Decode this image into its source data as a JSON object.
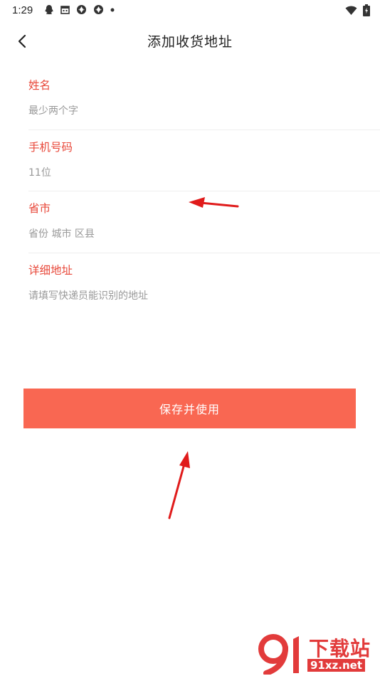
{
  "status_bar": {
    "time": "1:29",
    "left_icons": [
      "qq-icon",
      "calendar-icon",
      "aperture-icon",
      "aperture-icon",
      "dot-icon"
    ],
    "right_icons": [
      "wifi-icon",
      "battery-charging-icon"
    ]
  },
  "header": {
    "title": "添加收货地址"
  },
  "form": {
    "fields": [
      {
        "label": "姓名",
        "placeholder": "最少两个字",
        "value": ""
      },
      {
        "label": "手机号码",
        "placeholder": "11位",
        "value": ""
      },
      {
        "label": "省市",
        "placeholder": "省份 城市 区县",
        "value": ""
      },
      {
        "label": "详细地址",
        "placeholder": "请填写快递员能识别的地址",
        "value": ""
      }
    ]
  },
  "actions": {
    "save_label": "保存并使用"
  },
  "colors": {
    "accent": "#f96752",
    "label_red": "#e8483a",
    "annotation_arrow": "#e01b1b"
  },
  "watermark": {
    "top": "下载站",
    "bottom": "91xz.net"
  }
}
